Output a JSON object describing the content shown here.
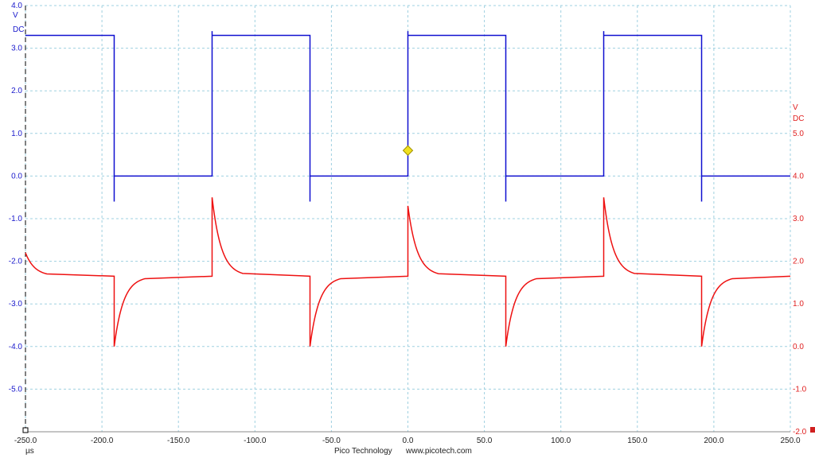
{
  "chart_data": {
    "type": "line",
    "x_axis": {
      "unit": "µs",
      "range": [
        -250,
        250
      ],
      "tick_labels": [
        "-250.0",
        "-200.0",
        "-150.0",
        "-100.0",
        "-50.0",
        "0.0",
        "50.0",
        "100.0",
        "150.0",
        "200.0",
        "250.0"
      ],
      "tick_values": [
        -250,
        -200,
        -150,
        -100,
        -50,
        0,
        50,
        100,
        150,
        200,
        250
      ]
    },
    "left_axis": {
      "unit_label": "V",
      "coupling_label": "DC",
      "range": [
        -6,
        4
      ],
      "tick_labels": [
        "4.0",
        "3.0",
        "2.0",
        "1.0",
        "0.0",
        "-1.0",
        "-2.0",
        "-3.0",
        "-4.0",
        "-5.0"
      ],
      "tick_values": [
        4,
        3,
        2,
        1,
        0,
        -1,
        -2,
        -3,
        -4,
        -5
      ],
      "color": "#1a1acc"
    },
    "right_axis": {
      "unit_label": "V",
      "coupling_label": "DC",
      "range": [
        -2,
        8
      ],
      "tick_labels": [
        "5.0",
        "4.0",
        "3.0",
        "2.0",
        "1.0",
        "0.0",
        "-1.0",
        "-2.0"
      ],
      "tick_values": [
        5,
        4,
        3,
        2,
        1,
        0,
        -1,
        -2
      ],
      "color": "#e02020"
    },
    "grid": true,
    "series": [
      {
        "axis": "left",
        "color": "#1010d0",
        "kind": "square",
        "high": 3.3,
        "low": 0.0,
        "rising_edges": [
          -128,
          0,
          128
        ],
        "falling_edges": [
          -192,
          -64,
          64,
          192
        ],
        "x_start": -250,
        "x_end": 250
      },
      {
        "axis": "right",
        "color": "#ee1111",
        "kind": "rc_spikes",
        "baseline": 1.65,
        "positive_peaks": [
          {
            "x": -128,
            "y": 3.5
          },
          {
            "x": 0,
            "y": 3.3
          },
          {
            "x": 128,
            "y": 3.5
          }
        ],
        "negative_peaks": [
          {
            "x": -192,
            "y": 0.0
          },
          {
            "x": -64,
            "y": 0.0
          },
          {
            "x": 64,
            "y": 0.0
          },
          {
            "x": 192,
            "y": 0.0
          }
        ],
        "initial_value": 2.2,
        "decay_us": 6
      }
    ],
    "trigger_marker": {
      "x": 0,
      "y": 0.6,
      "axis": "left",
      "color": "#f0e020"
    }
  },
  "footer": {
    "brand": "Pico Technology",
    "url": "www.picotech.com"
  }
}
